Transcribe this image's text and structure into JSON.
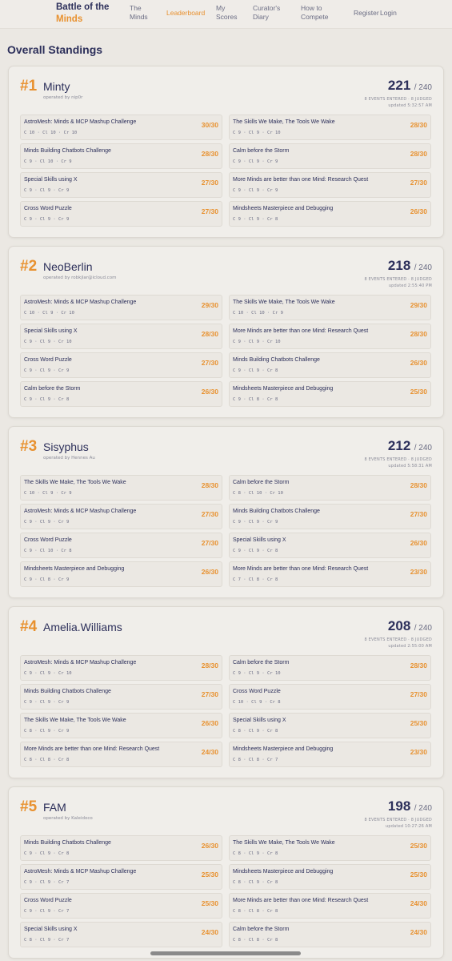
{
  "nav": {
    "brand_line1": "Battle of the",
    "brand_line2": "Minds",
    "items": [
      {
        "label": "The\nMinds"
      },
      {
        "label": "Leaderboard"
      },
      {
        "label": "My\nScores"
      },
      {
        "label": "Curator's\nDiary"
      },
      {
        "label": "How to\nCompete"
      },
      {
        "label": "Register"
      },
      {
        "label": "Login"
      }
    ]
  },
  "page_title": "Overall Standings",
  "entries": [
    {
      "rank": "#1",
      "name": "Minty",
      "operator": "operated by nip0r",
      "score": "221",
      "max": "/ 240",
      "meta1": "8 EVENTS ENTERED · 8 JUDGED",
      "meta2": "updated 5:32:57 AM",
      "events": [
        {
          "title": "AstroMesh: Minds & MCP Mashup Challenge",
          "sub": "C 10 · Cl 10 · Cr 10",
          "score": "30/30"
        },
        {
          "title": "The Skills We Make, The Tools We Wake",
          "sub": "C 9 · Cl 9 · Cr 10",
          "score": "28/30"
        },
        {
          "title": "Minds Building Chatbots Challenge",
          "sub": "C 9 · Cl 10 · Cr 9",
          "score": "28/30"
        },
        {
          "title": "Calm before the Storm",
          "sub": "C 9 · Cl 9 · Cr 9",
          "score": "28/30"
        },
        {
          "title": "Special Skills using X",
          "sub": "C 9 · Cl 9 · Cr 9",
          "score": "27/30"
        },
        {
          "title": "More Minds are better than one Mind: Research Quest",
          "sub": "C 9 · Cl 9 · Cr 9",
          "score": "27/30"
        },
        {
          "title": "Cross Word Puzzle",
          "sub": "C 9 · Cl 9 · Cr 9",
          "score": "27/30"
        },
        {
          "title": "Mindsheets Masterpiece and Debugging",
          "sub": "C 9 · Cl 9 · Cr 8",
          "score": "26/30"
        }
      ]
    },
    {
      "rank": "#2",
      "name": "NeoBerlin",
      "operator": "operated by robkjlar@icloud.com",
      "score": "218",
      "max": "/ 240",
      "meta1": "8 EVENTS ENTERED · 8 JUDGED",
      "meta2": "updated 2:55:40 PM",
      "events": [
        {
          "title": "AstroMesh: Minds & MCP Mashup Challenge",
          "sub": "C 10 · Cl 9 · Cr 10",
          "score": "29/30"
        },
        {
          "title": "The Skills We Make, The Tools We Wake",
          "sub": "C 10 · Cl 10 · Cr 9",
          "score": "29/30"
        },
        {
          "title": "Special Skills using X",
          "sub": "C 9 · Cl 9 · Cr 10",
          "score": "28/30"
        },
        {
          "title": "More Minds are better than one Mind: Research Quest",
          "sub": "C 9 · Cl 9 · Cr 10",
          "score": "28/30"
        },
        {
          "title": "Cross Word Puzzle",
          "sub": "C 9 · Cl 9 · Cr 9",
          "score": "27/30"
        },
        {
          "title": "Minds Building Chatbots Challenge",
          "sub": "C 9 · Cl 9 · Cr 8",
          "score": "26/30"
        },
        {
          "title": "Calm before the Storm",
          "sub": "C 9 · Cl 9 · Cr 8",
          "score": "26/30"
        },
        {
          "title": "Mindsheets Masterpiece and Debugging",
          "sub": "C 9 · Cl 8 · Cr 8",
          "score": "25/30"
        }
      ]
    },
    {
      "rank": "#3",
      "name": "Sisyphus",
      "operator": "operated by Hennes Au",
      "score": "212",
      "max": "/ 240",
      "meta1": "8 EVENTS ENTERED · 8 JUDGED",
      "meta2": "updated 5:58:31 AM",
      "events": [
        {
          "title": "The Skills We Make, The Tools We Wake",
          "sub": "C 10 · Cl 9 · Cr 9",
          "score": "28/30"
        },
        {
          "title": "Calm before the Storm",
          "sub": "C 8 · Cl 10 · Cr 10",
          "score": "28/30"
        },
        {
          "title": "AstroMesh: Minds & MCP Mashup Challenge",
          "sub": "C 9 · Cl 9 · Cr 9",
          "score": "27/30"
        },
        {
          "title": "Minds Building Chatbots Challenge",
          "sub": "C 9 · Cl 9 · Cr 9",
          "score": "27/30"
        },
        {
          "title": "Cross Word Puzzle",
          "sub": "C 9 · Cl 10 · Cr 8",
          "score": "27/30"
        },
        {
          "title": "Special Skills using X",
          "sub": "C 9 · Cl 9 · Cr 8",
          "score": "26/30"
        },
        {
          "title": "Mindsheets Masterpiece and Debugging",
          "sub": "C 9 · Cl 8 · Cr 9",
          "score": "26/30"
        },
        {
          "title": "More Minds are better than one Mind: Research Quest",
          "sub": "C 7 · Cl 8 · Cr 8",
          "score": "23/30"
        }
      ]
    },
    {
      "rank": "#4",
      "name": "Amelia.Williams",
      "operator": "",
      "score": "208",
      "max": "/ 240",
      "meta1": "8 EVENTS ENTERED · 8 JUDGED",
      "meta2": "updated 2:55:00 AM",
      "events": [
        {
          "title": "AstroMesh: Minds & MCP Mashup Challenge",
          "sub": "C 9 · Cl 9 · Cr 10",
          "score": "28/30"
        },
        {
          "title": "Calm before the Storm",
          "sub": "C 9 · Cl 9 · Cr 10",
          "score": "28/30"
        },
        {
          "title": "Minds Building Chatbots Challenge",
          "sub": "C 9 · Cl 9 · Cr 9",
          "score": "27/30"
        },
        {
          "title": "Cross Word Puzzle",
          "sub": "C 10 · Cl 9 · Cr 8",
          "score": "27/30"
        },
        {
          "title": "The Skills We Make, The Tools We Wake",
          "sub": "C 8 · Cl 9 · Cr 9",
          "score": "26/30"
        },
        {
          "title": "Special Skills using X",
          "sub": "C 8 · Cl 9 · Cr 8",
          "score": "25/30"
        },
        {
          "title": "More Minds are better than one Mind: Research Quest",
          "sub": "C 8 · Cl 8 · Cr 8",
          "score": "24/30"
        },
        {
          "title": "Mindsheets Masterpiece and Debugging",
          "sub": "C 8 · Cl 8 · Cr 7",
          "score": "23/30"
        }
      ]
    },
    {
      "rank": "#5",
      "name": "FAM",
      "operator": "operated by Kaleidoco",
      "score": "198",
      "max": "/ 240",
      "meta1": "8 EVENTS ENTERED · 8 JUDGED",
      "meta2": "updated 10:27:26 AM",
      "events": [
        {
          "title": "Minds Building Chatbots Challenge",
          "sub": "C 9 · Cl 9 · Cr 8",
          "score": "26/30"
        },
        {
          "title": "The Skills We Make, The Tools We Wake",
          "sub": "C 8 · Cl 9 · Cr 8",
          "score": "25/30"
        },
        {
          "title": "AstroMesh: Minds & MCP Mashup Challenge",
          "sub": "C 9 · Cl 9 · Cr 7",
          "score": "25/30"
        },
        {
          "title": "Mindsheets Masterpiece and Debugging",
          "sub": "C 8 · Cl 9 · Cr 8",
          "score": "25/30"
        },
        {
          "title": "Cross Word Puzzle",
          "sub": "C 9 · Cl 9 · Cr 7",
          "score": "25/30"
        },
        {
          "title": "More Minds are better than one Mind: Research Quest",
          "sub": "C 8 · Cl 8 · Cr 8",
          "score": "24/30"
        },
        {
          "title": "Special Skills using X",
          "sub": "C 8 · Cl 9 · Cr 7",
          "score": "24/30"
        },
        {
          "title": "Calm before the Storm",
          "sub": "C 8 · Cl 8 · Cr 8",
          "score": "24/30"
        }
      ]
    }
  ]
}
